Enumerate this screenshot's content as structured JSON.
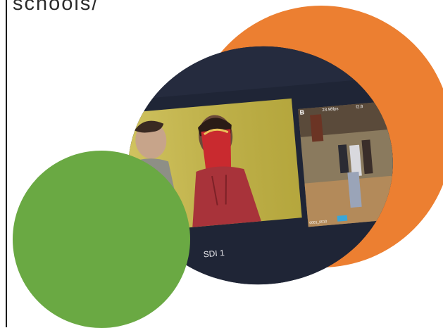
{
  "page": {
    "top_text": "schools/"
  },
  "photo": {
    "monitor_label": "SDI 1",
    "right_monitor_channel": "B",
    "right_monitor_fps": "23.98fps",
    "right_monitor_iris": "f2.8",
    "right_monitor_clip": "0001_0010"
  },
  "colors": {
    "orange": "#ec7f31",
    "green": "#6aa943",
    "monitor_frame": "#1d2433",
    "screen_wall": "#c9b944"
  },
  "icons": {
    "photo_subject": "film-set-monitor-photo"
  }
}
